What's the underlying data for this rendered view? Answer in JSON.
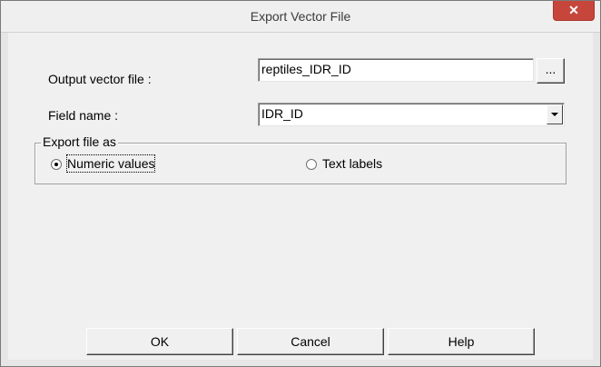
{
  "window": {
    "title": "Export Vector File",
    "close_glyph": "✕"
  },
  "fields": {
    "output_label": "Output vector file :",
    "output_value": "reptiles_IDR_ID",
    "browse_label": "...",
    "field_label": "Field name :",
    "field_value": "IDR_ID"
  },
  "group": {
    "title": "Export file as",
    "options": [
      {
        "label": "Numeric values",
        "selected": true
      },
      {
        "label": "Text labels",
        "selected": false
      }
    ]
  },
  "buttons": {
    "ok": "OK",
    "cancel": "Cancel",
    "help": "Help"
  }
}
